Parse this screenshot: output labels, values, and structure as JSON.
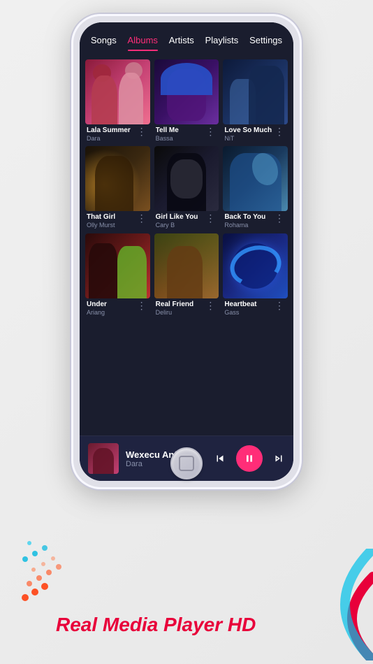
{
  "app": {
    "title": "Real Media Player HD"
  },
  "nav": {
    "tabs": [
      {
        "id": "songs",
        "label": "Songs",
        "active": false
      },
      {
        "id": "albums",
        "label": "Albums",
        "active": true
      },
      {
        "id": "artists",
        "label": "Artists",
        "active": false
      },
      {
        "id": "playlists",
        "label": "Playlists",
        "active": false
      },
      {
        "id": "settings",
        "label": "Settings",
        "active": false
      }
    ]
  },
  "albums": [
    {
      "title": "Lala Summer",
      "artist": "Dara",
      "style": "album-1"
    },
    {
      "title": "Tell Me",
      "artist": "Bassa",
      "style": "album-2"
    },
    {
      "title": "Love So Much",
      "artist": "NiT",
      "style": "album-3"
    },
    {
      "title": "That Girl",
      "artist": "Olly Murst",
      "style": "album-4"
    },
    {
      "title": "Girl Like You",
      "artist": "Cary B",
      "style": "album-5"
    },
    {
      "title": "Back To You",
      "artist": "Rohama",
      "style": "album-6"
    },
    {
      "title": "Under",
      "artist": "Ariang",
      "style": "album-7"
    },
    {
      "title": "Real Friend",
      "artist": "Deliru",
      "style": "album-8"
    },
    {
      "title": "Heartbeat",
      "artist": "Gass",
      "style": "album-9"
    }
  ],
  "now_playing": {
    "title": "Wexecu Anfane",
    "artist": "Dara",
    "is_playing": true
  },
  "bottom_brand": "Real Media Player HD",
  "colors": {
    "accent": "#ff2d78",
    "background": "#1a1d2e",
    "surface": "#1f2340",
    "text_primary": "#ffffff",
    "text_secondary": "#8890aa"
  },
  "icons": {
    "menu": "⋮",
    "prev": "⏮",
    "pause": "⏸",
    "next": "⏭"
  }
}
